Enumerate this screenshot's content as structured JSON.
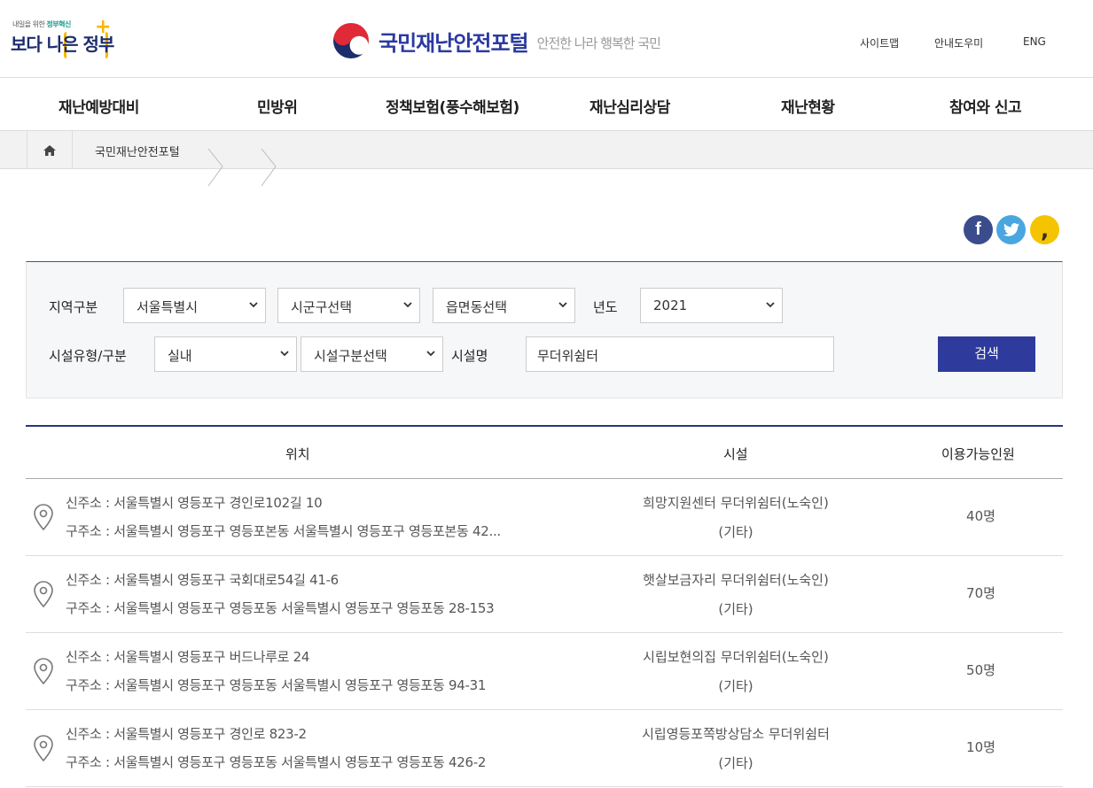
{
  "header": {
    "gov_logo_small": "내일을 위한",
    "gov_logo_small_accent": "정부혁신",
    "gov_logo_big": "보다 나은 정부",
    "portal_title": "국민재난안전포털",
    "portal_slogan": "안전한 나라 행복한 국민",
    "top_links": [
      "사이트맵",
      "안내도우미",
      "ENG"
    ]
  },
  "gnb": [
    "재난예방대비",
    "민방위",
    "정책보험(풍수해보험)",
    "재난심리상담",
    "재난현황",
    "참여와 신고"
  ],
  "breadcrumb": {
    "home_icon": "home-icon",
    "label": "국민재난안전포털"
  },
  "share": {
    "facebook_glyph": "f",
    "kakao_glyph": ","
  },
  "search": {
    "region_label": "지역구분",
    "sido": "서울특별시",
    "sigungu": "시군구선택",
    "eupmyeondong": "읍면동선택",
    "year_label": "년도",
    "year": "2021",
    "facility_type_label": "시설유형/구분",
    "facility_type": "실내",
    "facility_category": "시설구분선택",
    "facility_name_label": "시설명",
    "facility_name": "무더위쉼터",
    "search_button": "검색"
  },
  "table": {
    "headers": [
      "위치",
      "시설",
      "이용가능인원"
    ],
    "rows": [
      {
        "new_addr": "신주소 : 서울특별시 영등포구 경인로102길 10",
        "old_addr": "구주소 : 서울특별시 영등포구 영등포본동 서울특별시 영등포구 영등포본동 42...",
        "facility": "희망지원센터 무더위쉼터(노숙인)",
        "type": "(기타)",
        "capacity": "40명"
      },
      {
        "new_addr": "신주소 : 서울특별시 영등포구 국회대로54길 41-6",
        "old_addr": "구주소 : 서울특별시 영등포구 영등포동 서울특별시 영등포구 영등포동 28-153",
        "facility": "햇살보금자리 무더위쉼터(노숙인)",
        "type": "(기타)",
        "capacity": "70명"
      },
      {
        "new_addr": "신주소 : 서울특별시 영등포구 버드나루로 24",
        "old_addr": "구주소 : 서울특별시 영등포구 영등포동 서울특별시 영등포구 영등포동 94-31",
        "facility": "시립보현의집 무더위쉼터(노숙인)",
        "type": "(기타)",
        "capacity": "50명"
      },
      {
        "new_addr": "신주소 : 서울특별시 영등포구 경인로 823-2",
        "old_addr": "구주소 : 서울특별시 영등포구 영등포동 서울특별시 영등포구 영등포동 426-2",
        "facility": "시립영등포쪽방상담소 무더위쉼터",
        "type": "(기타)",
        "capacity": "10명"
      }
    ]
  }
}
